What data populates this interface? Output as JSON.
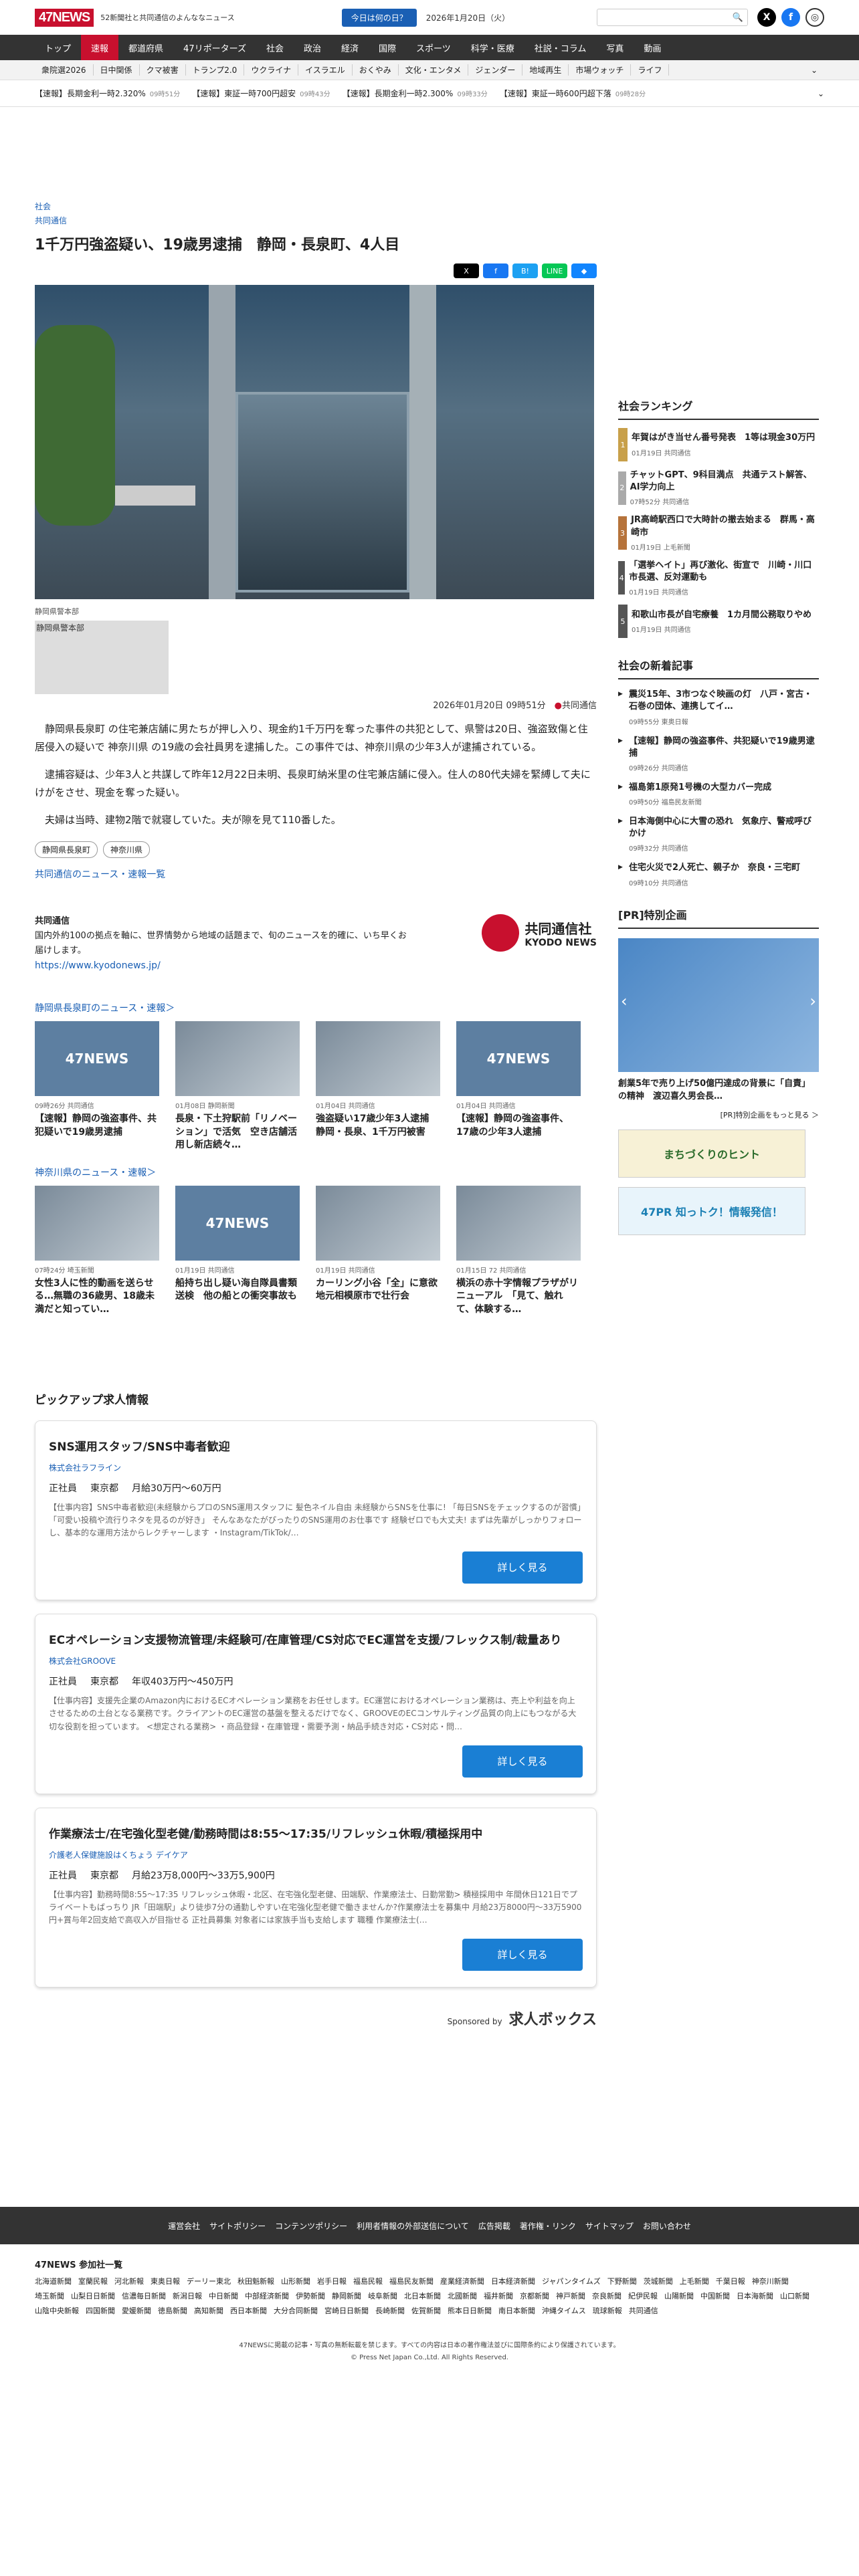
{
  "header": {
    "logo": "47NEWS",
    "tagline": "52新聞社と共同通信のよんななニュース",
    "today_btn": "今日は何の日？",
    "date": "2026年1月20日（火）",
    "search_icon": "🔍"
  },
  "nav_main": [
    "トップ",
    "速報",
    "都道府県",
    "47リポーターズ",
    "社会",
    "政治",
    "経済",
    "国際",
    "スポーツ",
    "科学・医療",
    "社説・コラム",
    "写真",
    "動画"
  ],
  "nav_topics": [
    "衆院選2026",
    "日中関係",
    "クマ被害",
    "トランプ2.0",
    "ウクライナ",
    "イスラエル",
    "おくやみ",
    "文化・エンタメ",
    "ジェンダー",
    "地域再生",
    "市場ウォッチ",
    "ライフ"
  ],
  "ticker": [
    {
      "text": "【速報】長期金利一時2.320%",
      "time": "09時51分"
    },
    {
      "text": "【速報】東証一時700円超安",
      "time": "09時43分"
    },
    {
      "text": "【速報】長期金利一時2.300%",
      "time": "09時33分"
    },
    {
      "text": "【速報】東証一時600円超下落",
      "time": "09時28分"
    }
  ],
  "article": {
    "category": "社会",
    "source": "共同通信",
    "title": "1千万円強盗疑い、19歳男逮捕　静岡・長泉町、4人目",
    "caption": "静岡県警本部",
    "broken_img_alt": "静岡県警本部",
    "meta_date": "2026年01月20日 09時51分",
    "meta_src": "共同通信",
    "paragraphs": [
      "静岡県長泉町 の住宅兼店舗に男たちが押し入り、現金約1千万円を奪った事件の共犯として、県警は20日、強盗致傷と住居侵入の疑いで 神奈川県 の19歳の会社員男を逮捕した。この事件では、神奈川県の少年3人が逮捕されている。",
      "逮捕容疑は、少年3人と共謀して昨年12月22日未明、長泉町納米里の住宅兼店舗に侵入。住人の80代夫婦を緊縛して夫にけがをさせ、現金を奪った疑い。",
      "夫婦は当時、建物2階で就寝していた。夫が隙を見て110番した。"
    ],
    "tags": [
      "静岡県長泉町",
      "神奈川県"
    ],
    "more_link": "共同通信のニュース・速報一覧"
  },
  "kyodo": {
    "name": "共同通信",
    "desc": "国内外約100の拠点を軸に、世界情勢から地域の話題まで、旬のニュースを的確に、いち早くお届けします。",
    "url": "https://www.kyodonews.jp/",
    "logo_text": "共同通信社",
    "logo_sub": "KYODO NEWS"
  },
  "sec1": {
    "title": "静岡県長泉町のニュース・速報＞",
    "cards": [
      {
        "img": "47NEWS",
        "meta": "09時26分 共同通信",
        "title": "【速報】静岡の強盗事件、共犯疑いで19歳男逮捕"
      },
      {
        "img": "",
        "meta": "01月08日 静岡新聞",
        "title": "長泉・下土狩駅前「リノベーション」で活気　空き店舗活用し新店続々…"
      },
      {
        "img": "",
        "meta": "01月04日 共同通信",
        "title": "強盗疑い17歳少年3人逮捕　静岡・長泉、1千万円被害"
      },
      {
        "img": "47NEWS",
        "meta": "01月04日 共同通信",
        "title": "【速報】静岡の強盗事件、17歳の少年3人逮捕"
      }
    ]
  },
  "sec2": {
    "title": "神奈川県のニュース・速報＞",
    "cards": [
      {
        "img": "",
        "meta": "07時24分 埼玉新聞",
        "title": "女性3人に性的動画を送らせる…無職の36歳男、18歳未満だと知ってい…"
      },
      {
        "img": "47NEWS",
        "meta": "01月19日 共同通信",
        "title": "船持ち出し疑い海自隊員書類送検　他の船との衝突事故も"
      },
      {
        "img": "",
        "meta": "01月19日 共同通信",
        "title": "カーリング小谷「全」に意欲　地元相模原市で壮行会"
      },
      {
        "img": "",
        "meta": "01月15日 72 共同通信",
        "title": "横浜の赤十字情報プラザがリニューアル　「見て、触れて、体験する…"
      }
    ]
  },
  "jobs": {
    "title": "ピックアップ求人情報",
    "items": [
      {
        "title": "SNS運用スタッフ/SNS中毒者歓迎",
        "company": "株式会社ラフライン",
        "type": "正社員",
        "loc": "東京都",
        "pay": "月給30万円〜60万円",
        "desc": "【仕事内容】SNS中毒者歓迎(未経験からプロのSNS運用スタッフに 髪色ネイル自由 未経験からSNSを仕事に! 「毎日SNSをチェックするのが習慣」「可愛い投稿や流行りネタを見るのが好き」 そんなあなたがぴったりのSNS運用のお仕事です 経験ゼロでも大丈夫! まずは先輩がしっかりフォローし、基本的な運用方法からレクチャーします ・Instagram/TikTok/…",
        "btn": "詳しく見る"
      },
      {
        "title": "ECオペレーション支援物流管理/未経験可/在庫管理/CS対応でEC運営を支援/フレックス制/裁量あり",
        "company": "株式会社GROOVE",
        "type": "正社員",
        "loc": "東京都",
        "pay": "年収403万円〜450万円",
        "desc": "【仕事内容】支援先企業のAmazon内におけるECオペレーション業務をお任せします。EC運営におけるオペレーション業務は、売上や利益を向上させるための土台となる業務です。クライアントのEC運営の基盤を整えるだけでなく、GROOVEのECコンサルティング品質の向上にもつながる大切な役割を担っています。 <想定される業務> ・商品登録・在庫管理・需要予測・納品手続き対応・CS対応・問…",
        "btn": "詳しく見る"
      },
      {
        "title": "作業療法士/在宅強化型老健/勤務時間は8:55〜17:35/リフレッシュ休暇/積極採用中",
        "company": "介護老人保健施設はくちょう デイケア",
        "type": "正社員",
        "loc": "東京都",
        "pay": "月給23万8,000円〜33万5,900円",
        "desc": "【仕事内容】勤務時間8:55〜17:35 リフレッシュ休暇・北区、在宅強化型老健、田端駅、作業療法士、日勤常勤> 積極採用中 年間休日121日でプライベートもばっちり JR「田端駅」より徒歩7分の通勤しやすい在宅強化型老健で働きませんか?作業療法士を募集中 月給23万8000円〜33万5900円+賞与年2回支給で高収入が目指せる 正社員募集 対象者には家族手当も支給します 職種 作業療法士(…",
        "btn": "詳しく見る"
      }
    ],
    "sponsor_label": "Sponsored by",
    "sponsor_name": "求人ボックス"
  },
  "sidebar": {
    "ranking_title": "社会ランキング",
    "ranking": [
      {
        "title": "年賀はがき当せん番号発表　1等は現金30万円",
        "meta": "01月19日 共同通信"
      },
      {
        "title": "チャットGPT、9科目満点　共通テスト解答、AI学力向上",
        "meta": "07時52分 共同通信"
      },
      {
        "title": "JR高崎駅西口で大時計の撤去始まる　群馬・高崎市",
        "meta": "01月19日 上毛新聞"
      },
      {
        "title": "「選挙ヘイト」再び激化、街宣で　川崎・川口市長選、反対運動も",
        "meta": "01月19日 共同通信"
      },
      {
        "title": "和歌山市長が自宅療養　1カ月間公務取りやめ",
        "meta": "01月19日 共同通信"
      }
    ],
    "new_title": "社会の新着記事",
    "new_items": [
      {
        "title": "震災15年、3市つなぐ映画の灯　八戸・宮古・石巻の団体、連携してイ…",
        "meta": "09時55分 東奥日報"
      },
      {
        "title": "【速報】静岡の強盗事件、共犯疑いで19歳男逮捕",
        "meta": "09時26分 共同通信"
      },
      {
        "title": "福島第1原発1号機の大型カバー完成",
        "meta": "09時50分 福島民友新聞"
      },
      {
        "title": "日本海側中心に大雪の恐れ　気象庁、警戒呼びかけ",
        "meta": "09時32分 共同通信"
      },
      {
        "title": "住宅火災で2人死亡、親子か　奈良・三宅町",
        "meta": "09時10分 共同通信"
      }
    ],
    "pr_title": "[PR]特別企画",
    "pr_headline": "創業5年で売り上げ50億円達成の背景に「自責」の精神　渡辺喜久男会長…",
    "pr_more": "[PR]特別企画をもっと見る ＞",
    "ad1": "まちづくりのヒント",
    "ad2": "47PR 知っトク！情報発信！"
  },
  "footer": {
    "nav": [
      "運営会社",
      "サイトポリシー",
      "コンテンツポリシー",
      "利用者情報の外部送信について",
      "広告掲載",
      "著作権・リンク",
      "サイトマップ",
      "お問い合わせ"
    ],
    "members_title": "47NEWS 参加社一覧",
    "members": [
      "北海道新聞",
      "室蘭民報",
      "河北新報",
      "東奥日報",
      "デーリー東北",
      "秋田魁新報",
      "山形新聞",
      "岩手日報",
      "福島民報",
      "福島民友新聞",
      "産業経済新聞",
      "日本経済新聞",
      "ジャパンタイムズ",
      "下野新聞",
      "茨城新聞",
      "上毛新聞",
      "千葉日報",
      "神奈川新聞",
      "埼玉新聞",
      "山梨日日新聞",
      "信濃毎日新聞",
      "新潟日報",
      "中日新聞",
      "中部経済新聞",
      "伊勢新聞",
      "静岡新聞",
      "岐阜新聞",
      "北日本新聞",
      "北國新聞",
      "福井新聞",
      "京都新聞",
      "神戸新聞",
      "奈良新聞",
      "紀伊民報",
      "山陽新聞",
      "中国新聞",
      "日本海新聞",
      "山口新聞",
      "山陰中央新報",
      "四国新聞",
      "愛媛新聞",
      "徳島新聞",
      "高知新聞",
      "西日本新聞",
      "大分合同新聞",
      "宮崎日日新聞",
      "長崎新聞",
      "佐賀新聞",
      "熊本日日新聞",
      "南日本新聞",
      "沖縄タイムス",
      "琉球新報",
      "共同通信"
    ],
    "notice": "47NEWSに掲載の記事・写真の無断転載を禁じます。すべての内容は日本の著作権法並びに国際条約により保護されています。",
    "copyright": "© Press Net Japan Co.,Ltd. All Rights Reserved."
  }
}
